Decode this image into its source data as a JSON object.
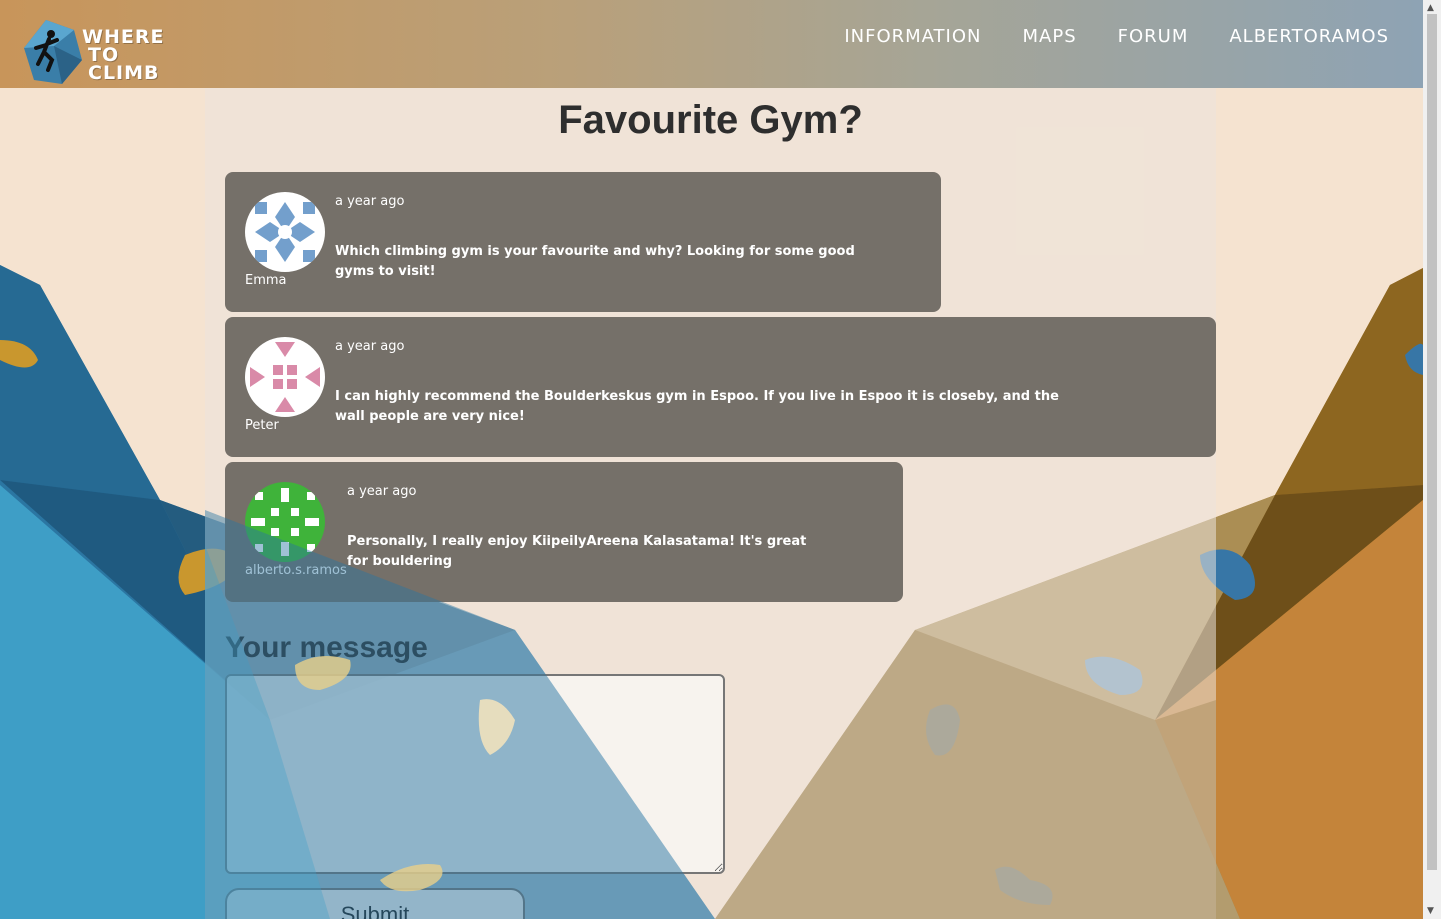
{
  "header": {
    "logo_line1": "WHERE",
    "logo_line2": "TO CLIMB",
    "nav": [
      "INFORMATION",
      "MAPS",
      "FORUM",
      "ALBERTORAMOS"
    ]
  },
  "thread": {
    "title": "Favourite Gym?"
  },
  "posts": [
    {
      "author": "Emma",
      "time": "a year ago",
      "message": "Which climbing gym is your favourite and why? Looking for some good gyms to visit!",
      "avatar_color": "#5b8fc4"
    },
    {
      "author": "Peter",
      "time": "a year ago",
      "message": "I can highly recommend the Boulderkeskus gym in Espoo. If you live in Espoo it is closeby, and the wall people are very nice!",
      "avatar_color": "#d98aa8"
    },
    {
      "author": "alberto.s.ramos",
      "time": "a year ago",
      "message": "Personally, I really enjoy KiipeilyAreena Kalasatama! It's great for bouldering",
      "avatar_color": "#3fb33a"
    }
  ],
  "reply": {
    "heading": "Your message",
    "value": "",
    "submit_label": "Submit"
  },
  "colors": {
    "post_bg": "#757069",
    "page_bg": "#f5e3d0",
    "wall_blue": "#2a6f98",
    "wall_orange": "#b57a2c"
  }
}
